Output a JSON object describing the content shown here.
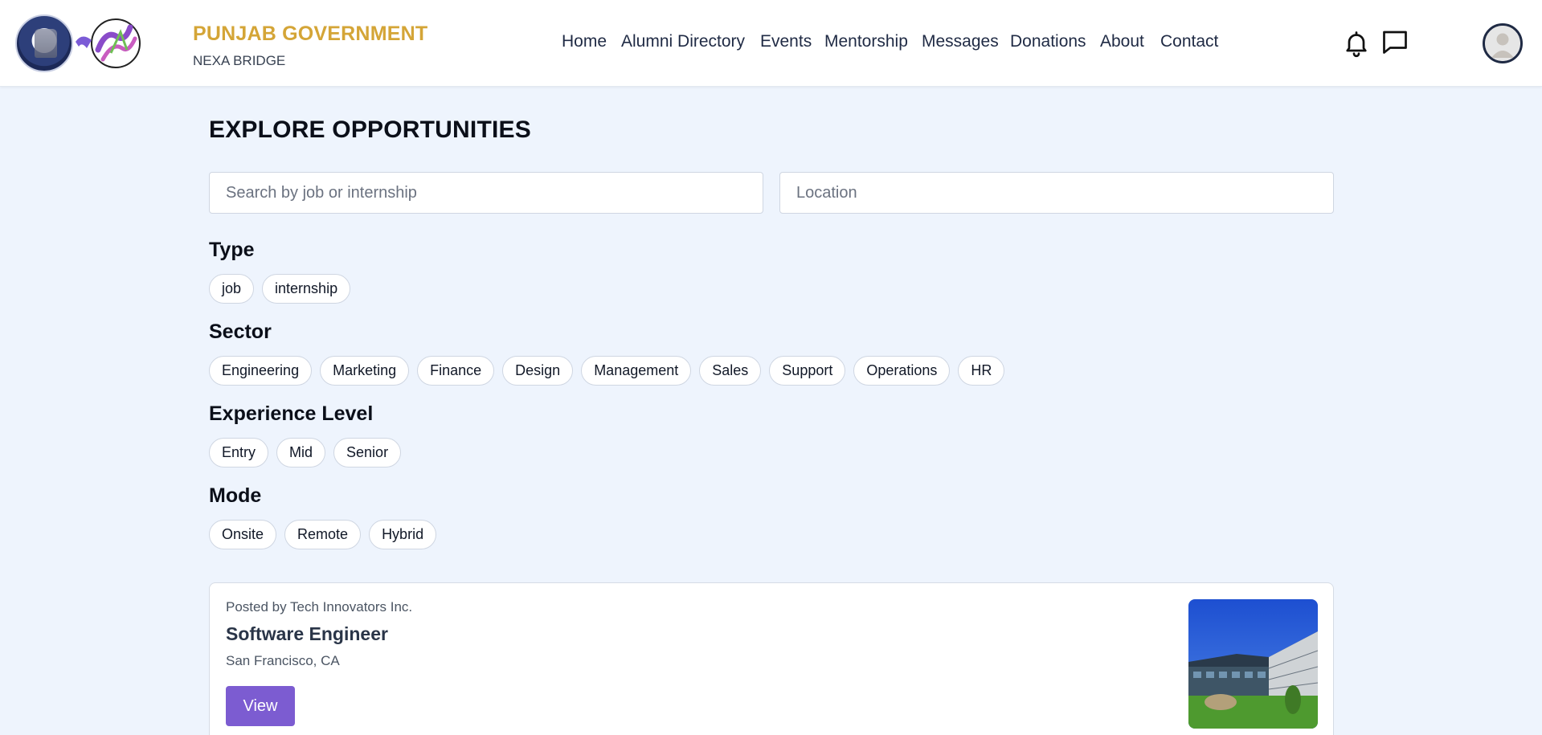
{
  "header": {
    "brand_title": "PUNJAB GOVERNMENT",
    "brand_subtitle": "NEXA BRIDGE",
    "nav": [
      {
        "label": "Home"
      },
      {
        "label": "Alumni Directory"
      },
      {
        "label": "Events"
      },
      {
        "label": "Mentorship"
      },
      {
        "label": "Messages"
      },
      {
        "label": "Donations"
      },
      {
        "label": "About"
      },
      {
        "label": "Contact"
      }
    ],
    "icons": {
      "notifications": "bell-icon",
      "chat": "chat-bubble-icon",
      "profile": "user-avatar-icon"
    }
  },
  "main": {
    "title": "EXPLORE OPPORTUNITIES",
    "search": {
      "placeholder": "Search by job or internship",
      "value": ""
    },
    "location": {
      "placeholder": "Location",
      "value": ""
    },
    "filters": {
      "type": {
        "label": "Type",
        "options": [
          "job",
          "internship"
        ]
      },
      "sector": {
        "label": "Sector",
        "options": [
          "Engineering",
          "Marketing",
          "Finance",
          "Design",
          "Management",
          "Sales",
          "Support",
          "Operations",
          "HR"
        ]
      },
      "experience": {
        "label": "Experience Level",
        "options": [
          "Entry",
          "Mid",
          "Senior"
        ]
      },
      "mode": {
        "label": "Mode",
        "options": [
          "Onsite",
          "Remote",
          "Hybrid"
        ]
      }
    },
    "listings": [
      {
        "posted_by": "Posted by Tech Innovators Inc.",
        "title": "Software Engineer",
        "location": "San Francisco, CA",
        "button": "View"
      }
    ]
  },
  "colors": {
    "brand_gold": "#d4a537",
    "accent_purple": "#7c5cd1",
    "page_background": "#eef4fd",
    "nav_text": "#1f2a44"
  }
}
